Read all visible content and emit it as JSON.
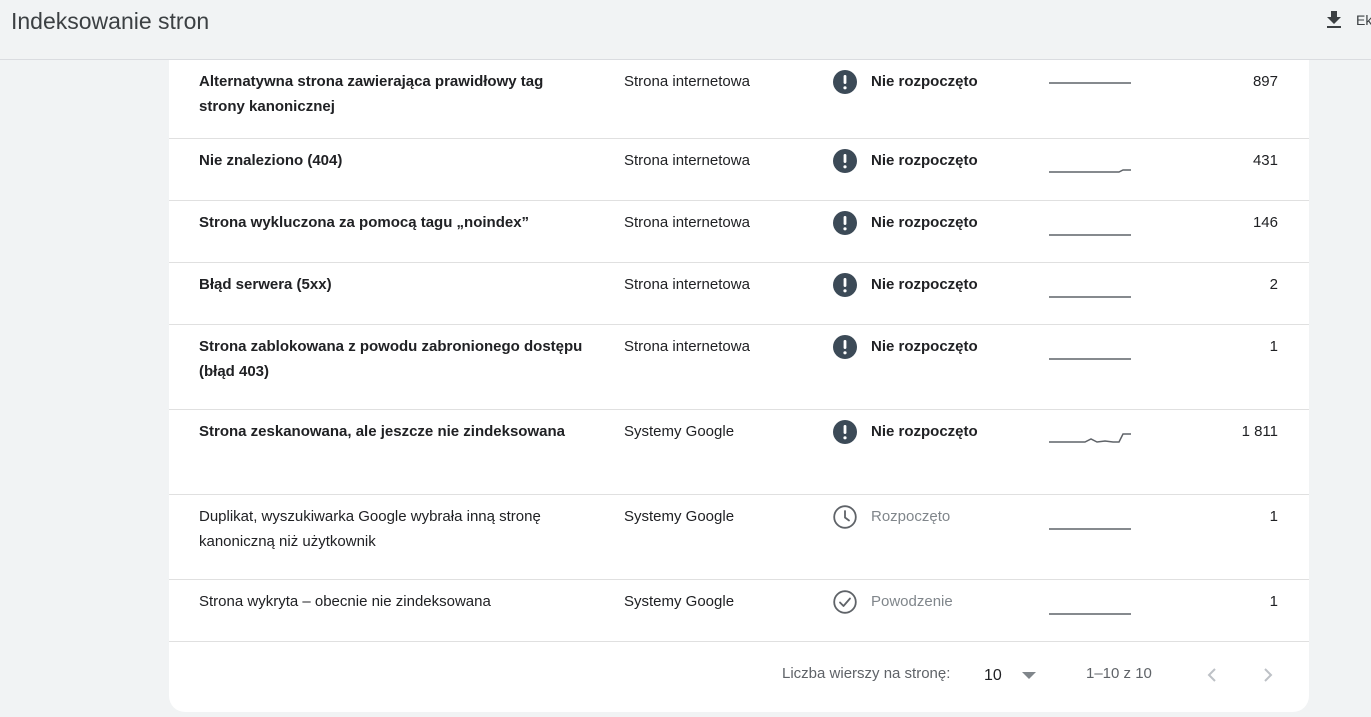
{
  "header": {
    "title": "Indeksowanie stron",
    "export_label": "Ek",
    "export_icon": "download-icon"
  },
  "rows": [
    {
      "reason": "Alternatywna strona zawierająca prawidłowy tag strony kanonicznej",
      "source": "Strona internetowa",
      "status": "Nie rozpoczęto",
      "status_icon": "alert-circle-icon",
      "count": "897"
    },
    {
      "reason": "Nie znaleziono (404)",
      "source": "Strona internetowa",
      "status": "Nie rozpoczęto",
      "status_icon": "alert-circle-icon",
      "count": "431"
    },
    {
      "reason": "Strona wykluczona za pomocą tagu „noindex”",
      "source": "Strona internetowa",
      "status": "Nie rozpoczęto",
      "status_icon": "alert-circle-icon",
      "count": "146"
    },
    {
      "reason": "Błąd serwera (5xx)",
      "source": "Strona internetowa",
      "status": "Nie rozpoczęto",
      "status_icon": "alert-circle-icon",
      "count": "2"
    },
    {
      "reason": "Strona zablokowana z powodu zabronionego dostępu (błąd 403)",
      "source": "Strona internetowa",
      "status": "Nie rozpoczęto",
      "status_icon": "alert-circle-icon",
      "count": "1"
    },
    {
      "reason": "Strona zeskanowana, ale jeszcze nie zindeksowana",
      "source": "Systemy Google",
      "status": "Nie rozpoczęto",
      "status_icon": "alert-circle-icon",
      "count": "1 811"
    },
    {
      "reason": "Duplikat, wyszukiwarka Google wybrała inną stronę kanoniczną niż użytkownik",
      "source": "Systemy Google",
      "status": "Rozpoczęto",
      "status_icon": "clock-icon",
      "count": "1"
    },
    {
      "reason": "Strona wykryta – obecnie nie zindeksowana",
      "source": "Systemy Google",
      "status": "Powodzenie",
      "status_icon": "check-circle-icon",
      "count": "1"
    }
  ],
  "pagination": {
    "rows_per_page_label": "Liczba wierszy na stronę:",
    "rows_per_page_value": "10",
    "range_label": "1–10 z 10",
    "prev_icon": "chevron-left-icon",
    "next_icon": "chevron-right-icon"
  },
  "colors": {
    "alert": "#3c4a57",
    "muted": "#80868b",
    "divider": "#e0e0e0"
  }
}
